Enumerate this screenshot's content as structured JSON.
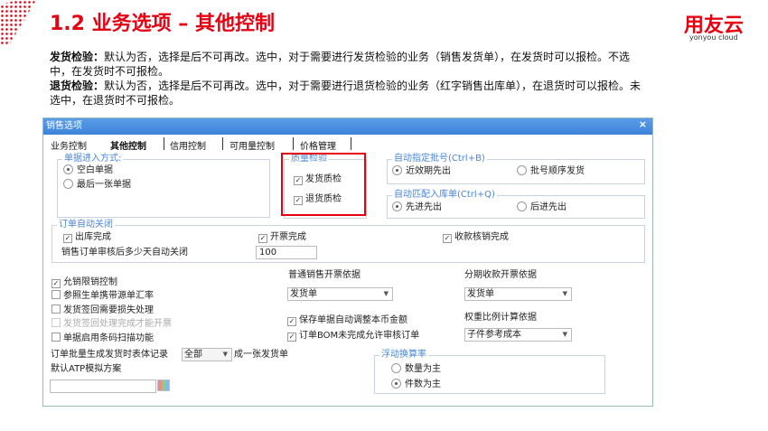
{
  "slide": {
    "title": "1.2  业务选项 – 其他控制",
    "logo": "用友云",
    "logo_sub": "yonyou cloud",
    "desc": [
      {
        "term": "发货检验：",
        "text": "默认为否，选择是后不可再改。选中，对于需要进行发货检验的业务（销售发货单），在发货时可以报检。不选中，在发货时不可报检。"
      },
      {
        "term": "退货检验：",
        "text": "默认为否，选择是后不可再改。选中，对于需要进行退货检验的业务（红字销售出库单），在退货时可以报检。未选中，在退货时不可报检。"
      }
    ]
  },
  "dialog": {
    "title": "销售选项",
    "close": "×",
    "tabs": [
      "业务控制",
      "其他控制",
      "信用控制",
      "可用量控制",
      "价格管理"
    ],
    "entry": {
      "legend": "单据进入方式:",
      "options": [
        "空白单据",
        "最后一张单据"
      ]
    },
    "quality": {
      "legend": "质量检验",
      "items": [
        "发货质检",
        "退货质检"
      ],
      "highlight": "#e60012"
    },
    "batch": {
      "legend": "自动指定批号(Ctrl+B)",
      "options": [
        "近效期先出",
        "批号顺序发货"
      ]
    },
    "match": {
      "legend": "自动匹配入库单(Ctrl+Q)",
      "options": [
        "先进先出",
        "后进先出"
      ]
    },
    "close_group": {
      "legend": "订单自动关闭",
      "items": [
        "出库完成",
        "开票完成",
        "收款核销完成"
      ],
      "days_label": "销售订单审核后多少天自动关闭",
      "days_value": "100"
    },
    "left_checks": [
      {
        "label": "允销限销控制",
        "checked": true
      },
      {
        "label": "参照生单携带源单汇率",
        "checked": false
      },
      {
        "label": "发货签回需要损失处理",
        "checked": false
      },
      {
        "label": "发货签回处理完成才能开票",
        "checked": false,
        "disabled": true
      },
      {
        "label": "单据启用条码扫描功能",
        "checked": false
      }
    ],
    "normal_invoice": {
      "label": "普通销售开票依据",
      "value": "发货单"
    },
    "install_invoice": {
      "label": "分期收款开票依据",
      "value": "发货单"
    },
    "mid_checks": [
      "保存单据自动调整本币金额",
      "订单BOM未完成允许审核订单"
    ],
    "weight": {
      "label": "权重比例计算依据",
      "value": "子件参考成本"
    },
    "batch_gen": {
      "prefix": "订单批量生成发货时表体记录",
      "value": "全部",
      "suffix": "成一张发货单"
    },
    "atp": {
      "label": "默认ATP模拟方案",
      "value": ""
    },
    "float_rate": {
      "legend": "浮动换算率",
      "options": [
        "数量为主",
        "件数为主"
      ]
    }
  }
}
